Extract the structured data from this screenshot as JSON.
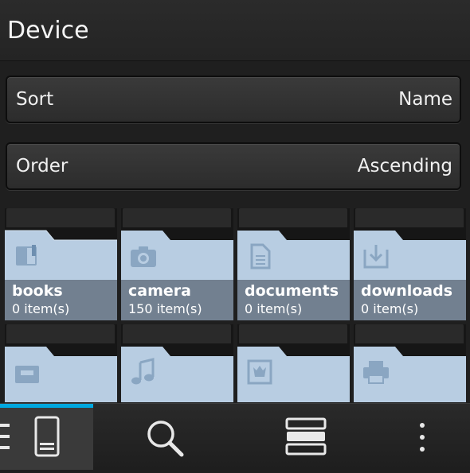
{
  "header": {
    "title": "Device"
  },
  "sort": {
    "label": "Sort",
    "value": "Name"
  },
  "order": {
    "label": "Order",
    "value": "Ascending"
  },
  "folders": [
    {
      "name": "books",
      "count": "0 item(s)",
      "icon": "book-icon"
    },
    {
      "name": "camera",
      "count": "150 item(s)",
      "icon": "camera-icon"
    },
    {
      "name": "documents",
      "count": "0 item(s)",
      "icon": "document-icon"
    },
    {
      "name": "downloads",
      "count": "0 item(s)",
      "icon": "download-icon"
    },
    {
      "name": "",
      "count": "",
      "icon": "inbox-icon"
    },
    {
      "name": "",
      "count": "",
      "icon": "music-icon"
    },
    {
      "name": "",
      "count": "",
      "icon": "picture-icon"
    },
    {
      "name": "",
      "count": "",
      "icon": "printer-icon"
    }
  ],
  "actionbar": {
    "items": [
      "menu-icon",
      "device-icon",
      "search-icon",
      "list-view-icon",
      "overflow-icon"
    ],
    "accent": "#00a8df"
  },
  "colors": {
    "folder": "#b8cde2",
    "folder_dark": "#9fb8d2",
    "caption": "#5a6574"
  }
}
